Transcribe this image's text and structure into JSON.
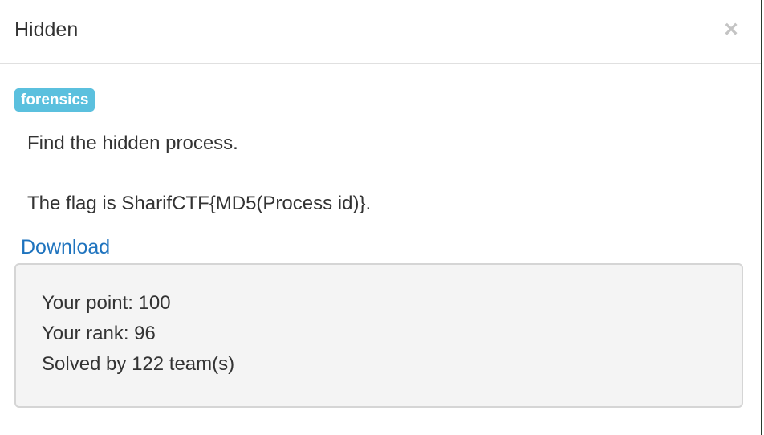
{
  "header": {
    "title": "Hidden",
    "close_label": "×"
  },
  "body": {
    "tag": "forensics",
    "description": [
      "Find the hidden process.",
      "The flag is SharifCTF{MD5(Process id)}."
    ],
    "download_label": "Download",
    "stats": {
      "point": "Your point: 100",
      "rank": "Your rank: 96",
      "solved": "Solved by 122 team(s)"
    }
  },
  "colors": {
    "tag_bg": "#5bc0de",
    "link": "#1e73be",
    "stats_bg": "#f4f4f4"
  }
}
